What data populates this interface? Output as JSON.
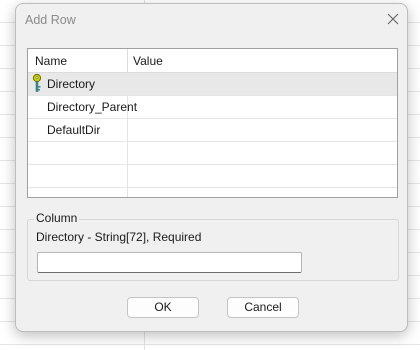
{
  "dialog": {
    "title": "Add Row",
    "close_icon": "close-icon"
  },
  "grid": {
    "columns": [
      "Name",
      "Value"
    ],
    "rows": [
      {
        "name": "Directory",
        "value": "",
        "icon": "key-icon",
        "selected": true
      },
      {
        "name": "Directory_Parent",
        "value": "",
        "selected": false
      },
      {
        "name": "DefaultDir",
        "value": "",
        "selected": false
      }
    ]
  },
  "column_group": {
    "label": "Column",
    "description": "Directory - String[72], Required",
    "input_value": ""
  },
  "buttons": {
    "ok": "OK",
    "cancel": "Cancel"
  },
  "colors": {
    "dialog_bg": "#f0f0f0",
    "selected_row": "#e8e8e8",
    "key_icon": "#b8c400"
  }
}
